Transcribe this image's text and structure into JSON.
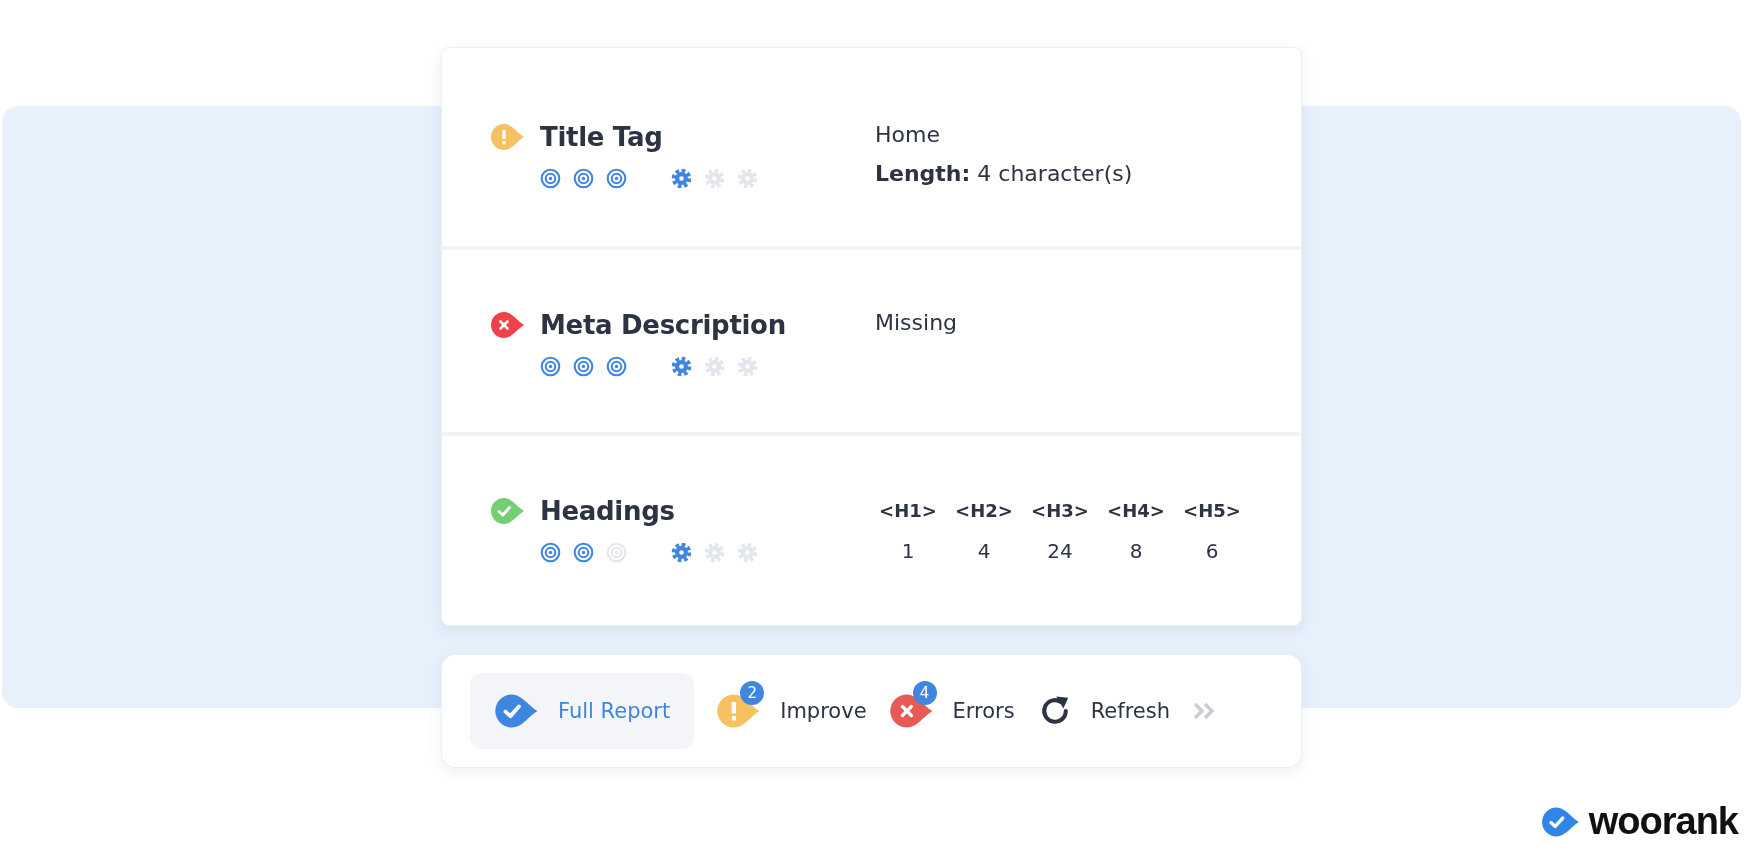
{
  "checks": [
    {
      "kind": "warning",
      "title": "Title Tag",
      "targets": [
        {
          "on": true
        },
        {
          "on": true
        },
        {
          "on": true
        }
      ],
      "gears": [
        {
          "on": true
        },
        {
          "on": false
        },
        {
          "on": false
        }
      ],
      "lines": [
        "Home",
        "**Length:** 4 character(s)"
      ]
    },
    {
      "kind": "error",
      "title": "Meta Description",
      "targets": [
        {
          "on": true
        },
        {
          "on": true
        },
        {
          "on": true
        }
      ],
      "gears": [
        {
          "on": true
        },
        {
          "on": false
        },
        {
          "on": false
        }
      ],
      "lines": [
        "Missing"
      ]
    },
    {
      "kind": "ok",
      "title": "Headings",
      "targets": [
        {
          "on": true
        },
        {
          "on": true
        },
        {
          "on": false
        }
      ],
      "gears": [
        {
          "on": true
        },
        {
          "on": false
        },
        {
          "on": false
        }
      ],
      "columns": [
        {
          "label": "<H1>",
          "value": "1"
        },
        {
          "label": "<H2>",
          "value": "4"
        },
        {
          "label": "<H3>",
          "value": "24"
        },
        {
          "label": "<H4>",
          "value": "8"
        },
        {
          "label": "<H5>",
          "value": "6"
        }
      ]
    }
  ],
  "toolbar": [
    {
      "kind": "report",
      "label": "Full Report",
      "selected": true
    },
    {
      "kind": "warning",
      "label": "Improve",
      "badge": "2",
      "selected": false
    },
    {
      "kind": "error",
      "label": "Errors",
      "badge": "4",
      "selected": false
    },
    {
      "kind": "refresh",
      "label": "Refresh",
      "selected": false
    }
  ],
  "logo": {
    "text": "woorank"
  }
}
